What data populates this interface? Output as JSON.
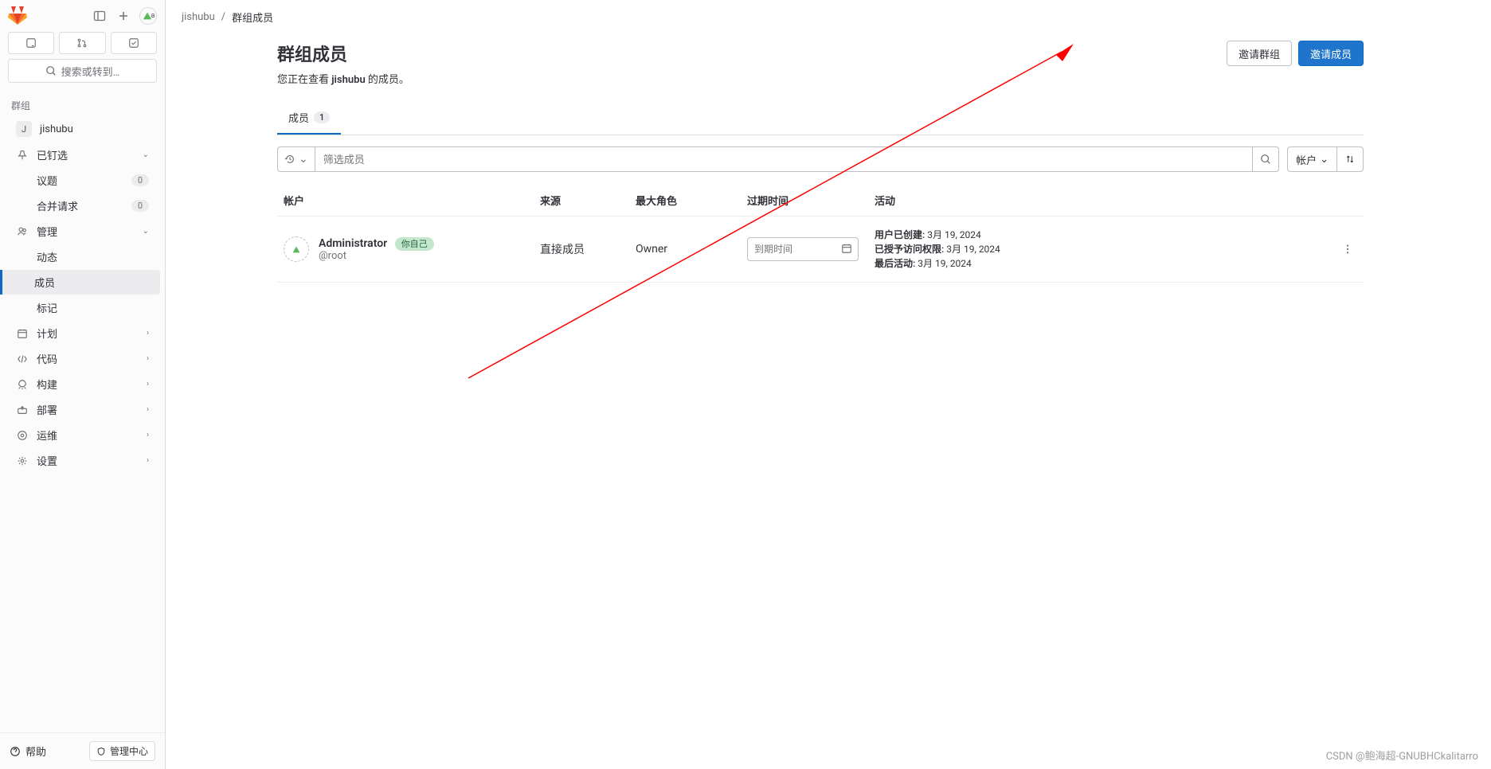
{
  "sidebar": {
    "avatar_label": "a",
    "search_placeholder": "搜索或转到…",
    "group_header": "群组",
    "group_name": "jishubu",
    "group_letter": "J",
    "pinned": "已钉选",
    "issues": {
      "label": "议题",
      "count": "0"
    },
    "merge": {
      "label": "合并请求",
      "count": "0"
    },
    "manage": "管理",
    "manage_sub": {
      "activity": "动态",
      "members": "成员",
      "labels": "标记"
    },
    "plan": "计划",
    "code": "代码",
    "build": "构建",
    "deploy": "部署",
    "operate": "运维",
    "settings": "设置",
    "help": "帮助",
    "admin": "管理中心"
  },
  "breadcrumb": {
    "group": "jishubu",
    "page": "群组成员"
  },
  "header": {
    "title": "群组成员",
    "sub_prefix": "您正在查看 ",
    "sub_strong": "jishubu",
    "sub_suffix": " 的成员。",
    "invite_group": "邀请群组",
    "invite_member": "邀请成员"
  },
  "tabs": {
    "members": "成员",
    "members_count": "1"
  },
  "filter": {
    "placeholder": "筛选成员",
    "sort_label": "帐户"
  },
  "table": {
    "headers": {
      "account": "帐户",
      "source": "来源",
      "role": "最大角色",
      "expire": "过期时间",
      "activity": "活动"
    },
    "row": {
      "name": "Administrator",
      "self_badge": "你自己",
      "username": "@root",
      "source": "直接成员",
      "role": "Owner",
      "expire_placeholder": "到期时间",
      "activity": {
        "created_label": "用户已创建:",
        "created_value": "3月 19, 2024",
        "access_label": "已授予访问权限:",
        "access_value": "3月 19, 2024",
        "last_label": "最后活动:",
        "last_value": "3月 19, 2024"
      }
    }
  },
  "watermark": "CSDN @鲍海超-GNUBHCkalitarro"
}
